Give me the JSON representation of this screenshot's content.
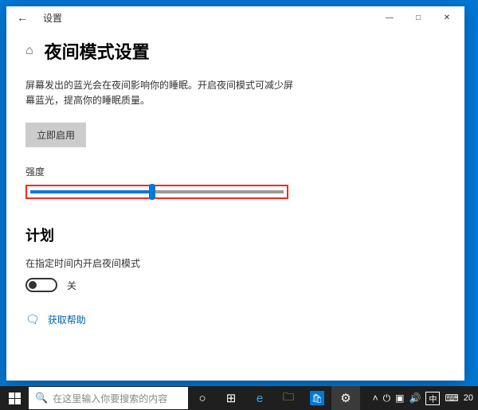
{
  "window": {
    "title": "设置",
    "controls": {
      "minimize": "—",
      "maximize": "□",
      "close": "✕"
    }
  },
  "page": {
    "title": "夜间模式设置",
    "description": "屏幕发出的蓝光会在夜间影响你的睡眠。开启夜间模式可减少屏幕蓝光，提高你的睡眠质量。",
    "enable_button": "立即启用"
  },
  "strength": {
    "label": "强度",
    "value_percent": 48
  },
  "schedule": {
    "title": "计划",
    "description": "在指定时间内开启夜间模式",
    "toggle_state": "关"
  },
  "help": {
    "label": "获取帮助"
  },
  "taskbar": {
    "search_placeholder": "在这里输入你要搜索的内容",
    "ime": "中",
    "clock": "20"
  }
}
